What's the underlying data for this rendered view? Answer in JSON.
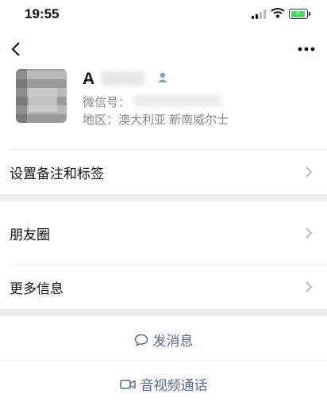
{
  "status_bar": {
    "time": "19:55",
    "icons": [
      "signal-icon",
      "wifi-icon",
      "battery-charging-icon"
    ]
  },
  "nav": {
    "back_icon": "chevron-left-icon",
    "more_icon": "ellipsis-icon"
  },
  "profile": {
    "name": "A",
    "wechat_id_label": "微信号：",
    "region": "地区：澳大利亚 新南威尔士",
    "icon": "contact-person-icon"
  },
  "menu": {
    "remark_tags": "设置备注和标签",
    "moments": "朋友圈",
    "more_info": "更多信息"
  },
  "actions": {
    "send_message": "发消息",
    "video_call": "音视频通话"
  },
  "colors": {
    "link": "#576b95",
    "gap": "#ededed",
    "battery": "#4cd964"
  }
}
